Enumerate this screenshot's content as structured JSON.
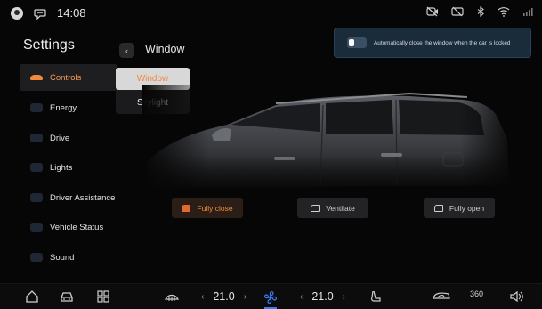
{
  "status_bar": {
    "time": "14:08",
    "icons": [
      "user-avatar-icon",
      "message-icon",
      "camera-off-icon",
      "screen-off-icon",
      "bluetooth-icon",
      "wifi-icon",
      "cellular-signal-icon"
    ]
  },
  "sidebar": {
    "title": "Settings",
    "items": [
      {
        "label": "Controls",
        "icon": "car-icon",
        "active": true
      },
      {
        "label": "Energy",
        "icon": "energy-icon",
        "active": false
      },
      {
        "label": "Drive",
        "icon": "drive-icon",
        "active": false
      },
      {
        "label": "Lights",
        "icon": "lights-icon",
        "active": false
      },
      {
        "label": "Driver Assistance",
        "icon": "driver-assistance-icon",
        "active": false
      },
      {
        "label": "Vehicle Status",
        "icon": "vehicle-status-icon",
        "active": false
      },
      {
        "label": "Sound",
        "icon": "sound-icon",
        "active": false
      }
    ]
  },
  "panel": {
    "back_icon": "chevron-left-icon",
    "title": "Window",
    "tabs": [
      {
        "label": "Window",
        "selected": true
      },
      {
        "label": "Skylight",
        "selected": false
      }
    ]
  },
  "auto_close": {
    "label": "Automatically close the window when the car is locked",
    "enabled": false
  },
  "window_buttons": [
    {
      "label": "Fully close",
      "icon": "window-closed-icon",
      "active": true
    },
    {
      "label": "Ventilate",
      "icon": "window-vent-icon",
      "active": false
    },
    {
      "label": "Fully open",
      "icon": "window-open-icon",
      "active": false
    }
  ],
  "dock": {
    "left_temp": "21.0",
    "right_temp": "21.0",
    "view_label": "360",
    "icons": [
      "home-icon",
      "car-icon",
      "apps-grid-icon",
      "defrost-icon",
      "fan-icon",
      "seat-heat-icon",
      "recirculation-icon",
      "camera-360-icon",
      "volume-icon"
    ]
  },
  "colors": {
    "accent": "#f08a3e",
    "fan_active": "#3c7bf5",
    "banner_bg": "#1a2b3a"
  }
}
